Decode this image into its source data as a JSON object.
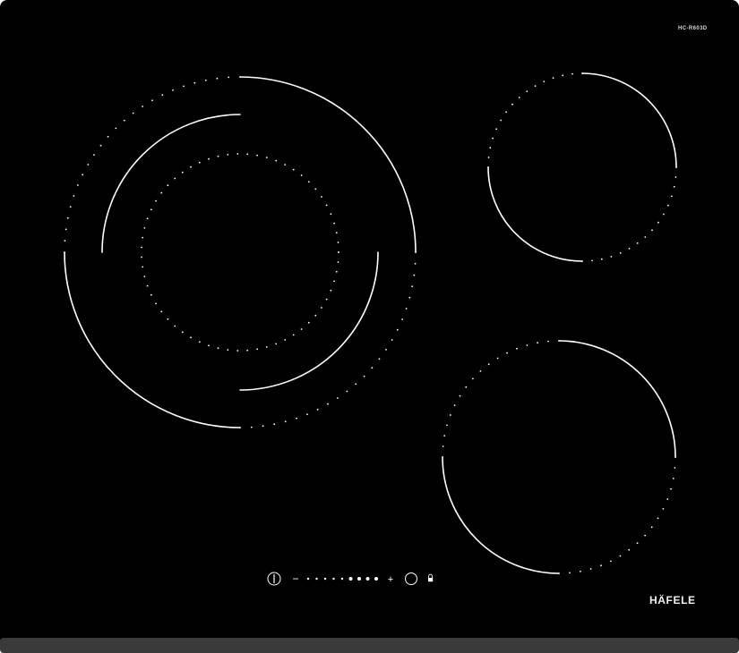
{
  "product": {
    "model_label": "HC-R603D",
    "brand_label": "HÄFELE"
  },
  "controls": {
    "power_icon": "power-icon",
    "minus_label": "−",
    "plus_label": "+",
    "timer_icon": "timer-icon",
    "lock_icon": "lock-icon",
    "power_levels": 9,
    "larger_dots_from": 6
  },
  "zones": [
    {
      "name": "zone-dual-left"
    },
    {
      "name": "zone-top-right"
    },
    {
      "name": "zone-bottom-right"
    }
  ],
  "colors": {
    "glass": "#000000",
    "line": "#ffffff",
    "frame_bottom": "#3a3a3a",
    "background": "#ffffff"
  }
}
